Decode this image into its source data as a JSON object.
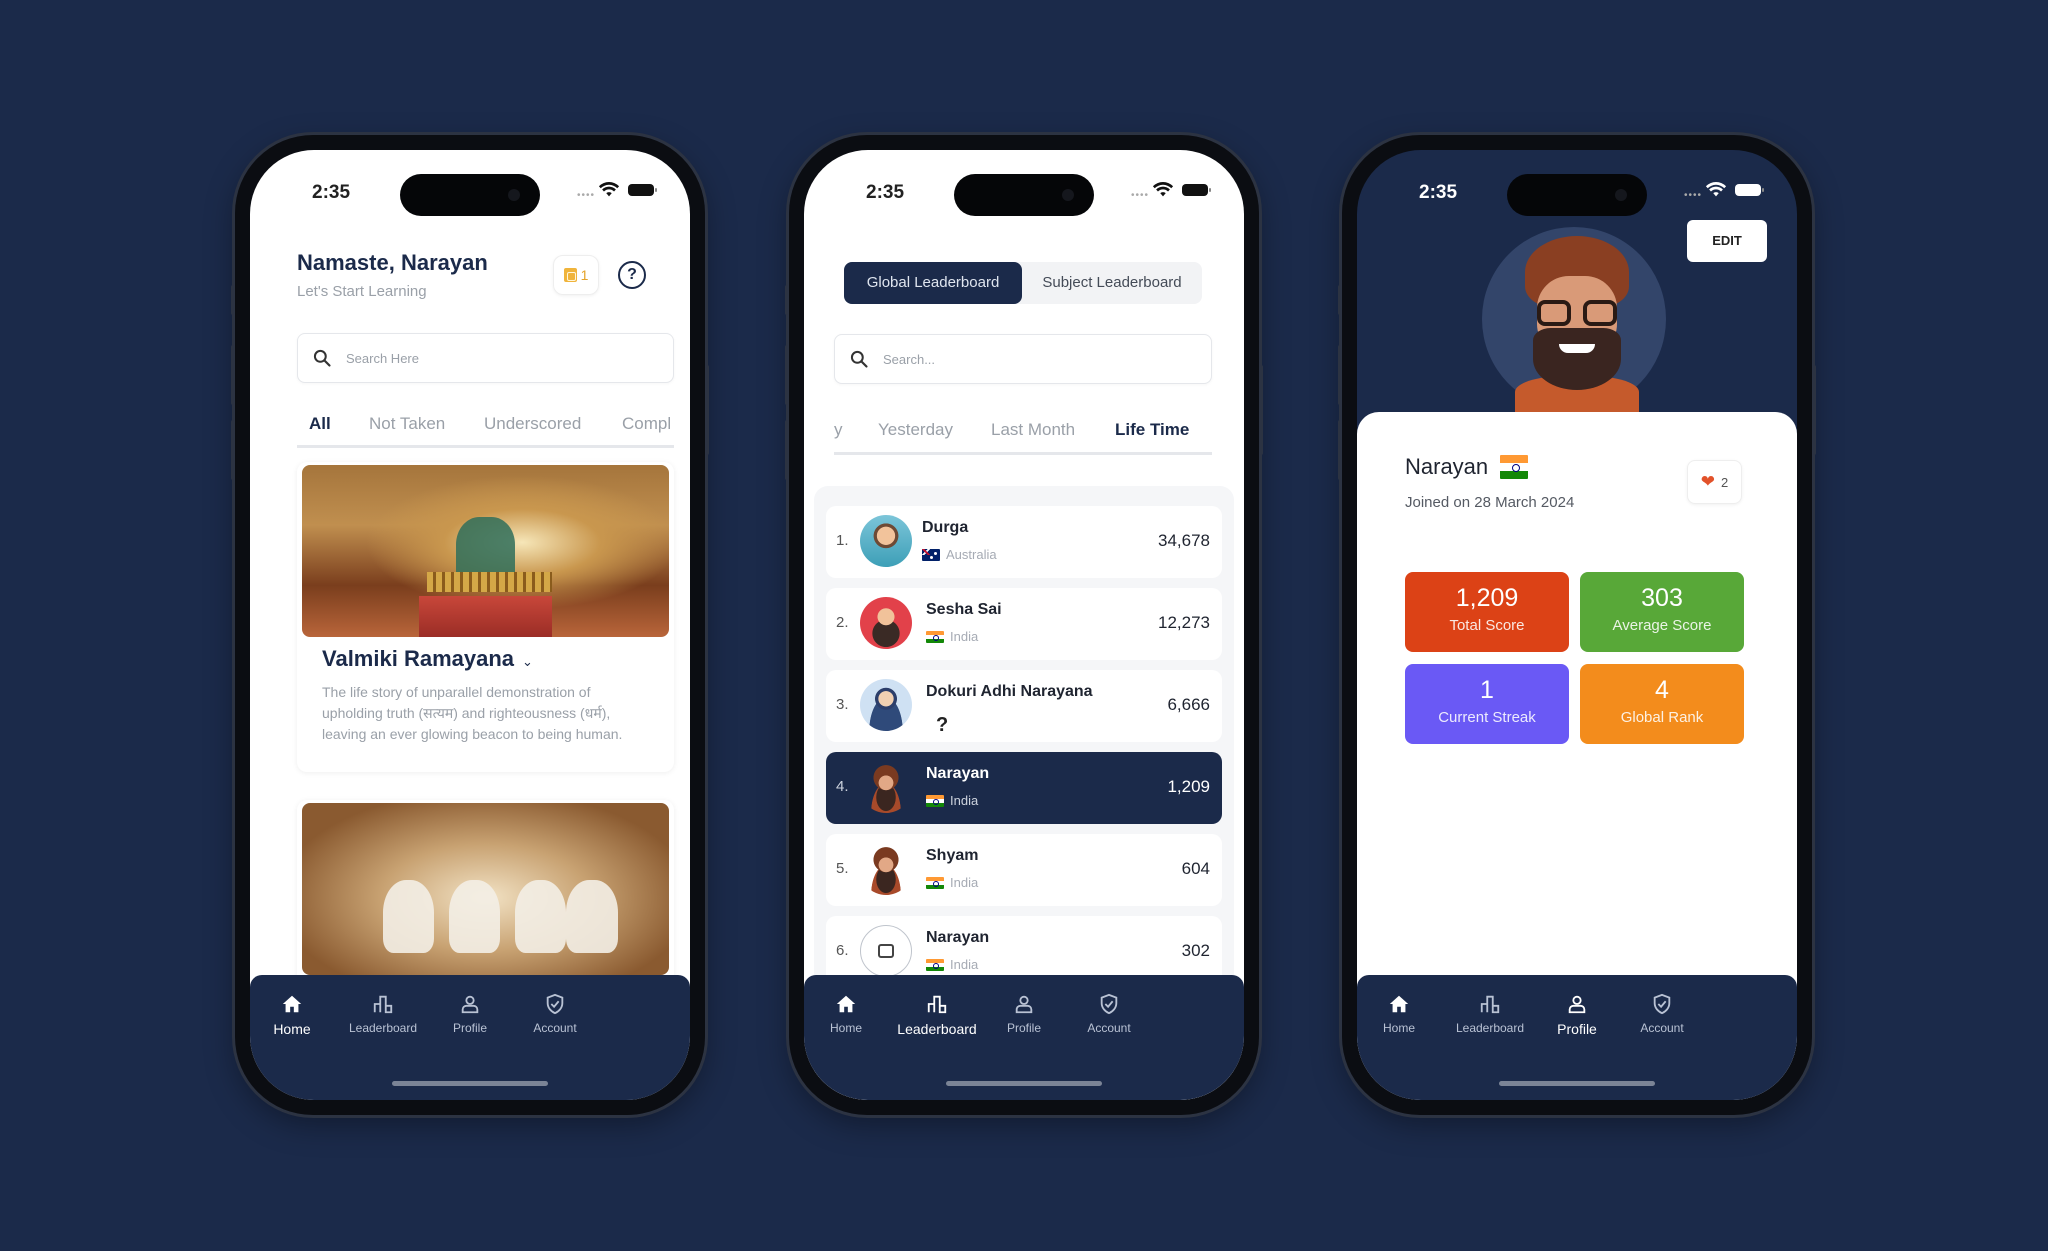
{
  "status_bar": {
    "time": "2:35"
  },
  "nav": {
    "items": [
      {
        "label": "Home",
        "icon": "home-icon"
      },
      {
        "label": "Leaderboard",
        "icon": "podium-icon"
      },
      {
        "label": "Profile",
        "icon": "user-icon"
      },
      {
        "label": "Account",
        "icon": "shield-check-icon"
      }
    ]
  },
  "home": {
    "greeting": "Namaste, Narayan",
    "subtitle": "Let's Start Learning",
    "coin_count": "1",
    "help_icon": "?",
    "search_placeholder": "Search Here",
    "tabs": [
      "All",
      "Not Taken",
      "Underscored",
      "Compl"
    ],
    "active_tab": "All",
    "cards": [
      {
        "title": "Valmiki Ramayana",
        "description": "The life story of unparallel demonstration of upholding truth (सत्यम) and righteousness (धर्म), leaving an ever glowing beacon to being human."
      },
      {
        "title": ""
      }
    ]
  },
  "leaderboard": {
    "segments": [
      "Global Leaderboard",
      "Subject Leaderboard"
    ],
    "active_segment": "Global Leaderboard",
    "search_placeholder": "Search...",
    "tabs": [
      "y",
      "Yesterday",
      "Last Month",
      "Life Time"
    ],
    "active_tab": "Life Time",
    "rows": [
      {
        "rank": "1.",
        "name": "Durga",
        "country": "Australia",
        "score": "34,678"
      },
      {
        "rank": "2.",
        "name": "Sesha Sai",
        "country": "India",
        "score": "12,273"
      },
      {
        "rank": "3.",
        "name": "Dokuri Adhi Narayana",
        "country": "?",
        "score": "6,666"
      },
      {
        "rank": "4.",
        "name": "Narayan",
        "country": "India",
        "score": "1,209",
        "highlighted": true
      },
      {
        "rank": "5.",
        "name": "Shyam",
        "country": "India",
        "score": "604"
      },
      {
        "rank": "6.",
        "name": "Narayan",
        "country": "India",
        "score": "302"
      }
    ]
  },
  "profile": {
    "edit_label": "EDIT",
    "name": "Narayan",
    "joined": "Joined on 28 March 2024",
    "likes": "2",
    "stats": [
      {
        "value": "1,209",
        "label": "Total Score",
        "color": "#dc4216"
      },
      {
        "value": "303",
        "label": "Average Score",
        "color": "#58a838"
      },
      {
        "value": "1",
        "label": "Current Streak",
        "color": "#6a59f5"
      },
      {
        "value": "4",
        "label": "Global Rank",
        "color": "#f38c1c"
      }
    ]
  },
  "colors": {
    "background": "#1b2a4a",
    "primary_navy": "#1b2a4a"
  }
}
